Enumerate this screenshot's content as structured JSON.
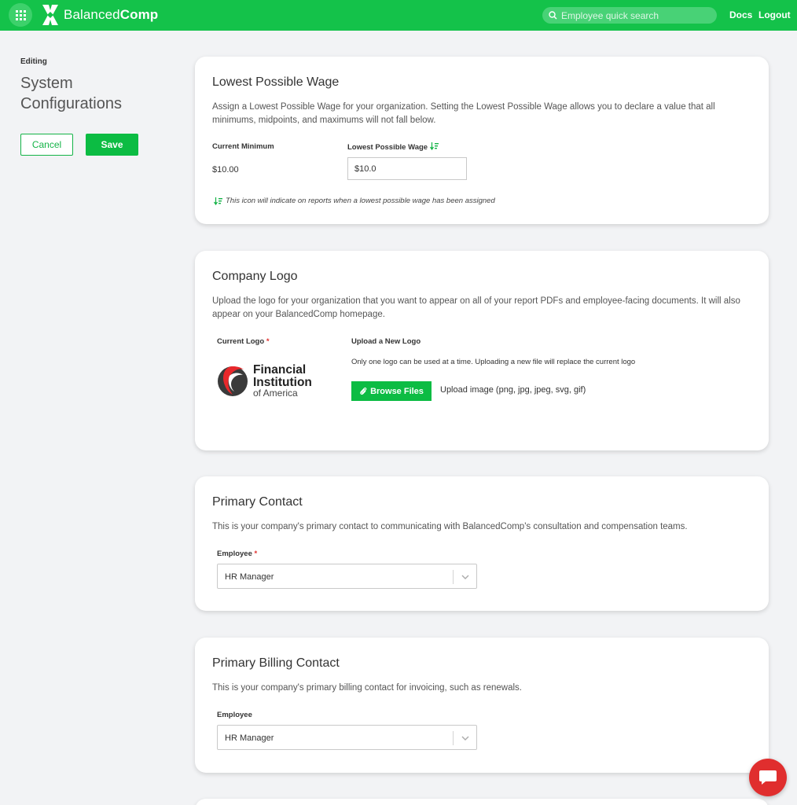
{
  "header": {
    "brand_light": "Balanced",
    "brand_bold": "Comp",
    "search_placeholder": "Employee quick search",
    "docs_label": "Docs",
    "logout_label": "Logout",
    "accent_color": "#14c24a"
  },
  "left_panel": {
    "editing_label": "Editing",
    "title": "System Configurations",
    "cancel_label": "Cancel",
    "save_label": "Save"
  },
  "lowest_wage": {
    "title": "Lowest Possible Wage",
    "description": "Assign a Lowest Possible Wage for your organization. Setting the Lowest Possible Wage allows you to declare a value that all minimums, midpoints, and maximums will not fall below.",
    "current_min_label": "Current Minimum",
    "current_min_value": "$10.00",
    "input_label": "Lowest Possible Wage",
    "input_value": "$10.0",
    "note": "This icon will indicate on reports when a lowest possible wage has been assigned",
    "icon": "sort-down-icon"
  },
  "company_logo": {
    "title": "Company Logo",
    "description": "Upload the logo for your organization that you want to appear on all of your report PDFs and employee-facing documents. It will also appear on your BalancedComp homepage.",
    "current_logo_label": "Current Logo",
    "upload_label": "Upload a New Logo",
    "upload_note": "Only one logo can be used at a time. Uploading a new file will replace the current logo",
    "browse_label": "Browse Files",
    "file_types": "Upload image (png, jpg, jpeg, svg, gif)",
    "logo_line1": "Financial",
    "logo_line2": "Institution",
    "logo_line3": "of America"
  },
  "primary_contact": {
    "title": "Primary Contact",
    "description": "This is your company's primary contact to communicating with BalancedComp's consultation and compensation teams.",
    "employee_label": "Employee",
    "selected": "HR Manager"
  },
  "billing_contact": {
    "title": "Primary Billing Contact",
    "description": "This is your company's primary billing contact for invoicing, such as renewals.",
    "employee_label": "Employee",
    "selected": "HR Manager"
  }
}
